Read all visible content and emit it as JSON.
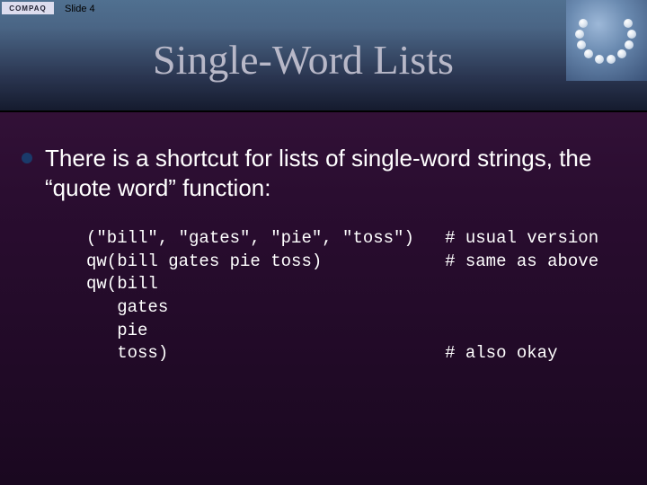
{
  "slide": {
    "indicator": "Slide 4",
    "title": "Single-Word Lists",
    "logo_text": "COMPAQ"
  },
  "bullet": {
    "text": "There is a shortcut for lists of single-word strings, the “quote word” function:"
  },
  "code": {
    "lines": "(\"bill\", \"gates\", \"pie\", \"toss\")   # usual version\nqw(bill gates pie toss)            # same as above\nqw(bill\n   gates\n   pie\n   toss)                           # also okay"
  }
}
